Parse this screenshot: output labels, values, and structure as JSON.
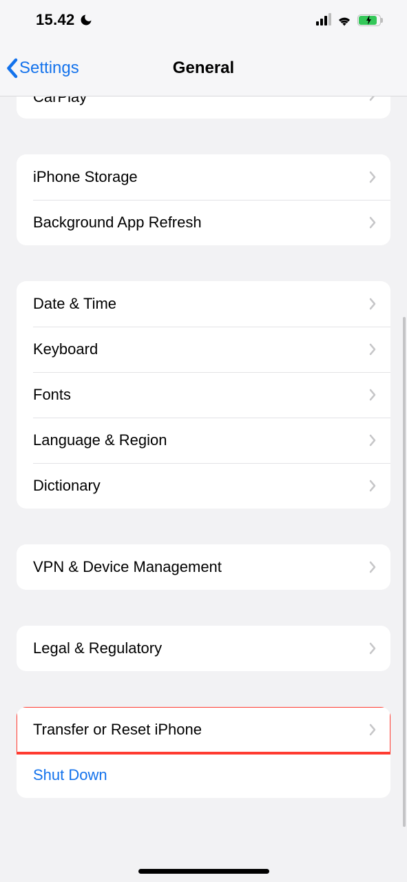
{
  "status": {
    "time": "15.42"
  },
  "nav": {
    "back_label": "Settings",
    "title": "General"
  },
  "partial_row": {
    "label": "CarPlay"
  },
  "group_storage": [
    {
      "label": "iPhone Storage"
    },
    {
      "label": "Background App Refresh"
    }
  ],
  "group_locale": [
    {
      "label": "Date & Time"
    },
    {
      "label": "Keyboard"
    },
    {
      "label": "Fonts"
    },
    {
      "label": "Language & Region"
    },
    {
      "label": "Dictionary"
    }
  ],
  "group_vpn": [
    {
      "label": "VPN & Device Management"
    }
  ],
  "group_legal": [
    {
      "label": "Legal & Regulatory"
    }
  ],
  "group_reset": [
    {
      "label": "Transfer or Reset iPhone",
      "highlight": true
    },
    {
      "label": "Shut Down",
      "action": true
    }
  ]
}
